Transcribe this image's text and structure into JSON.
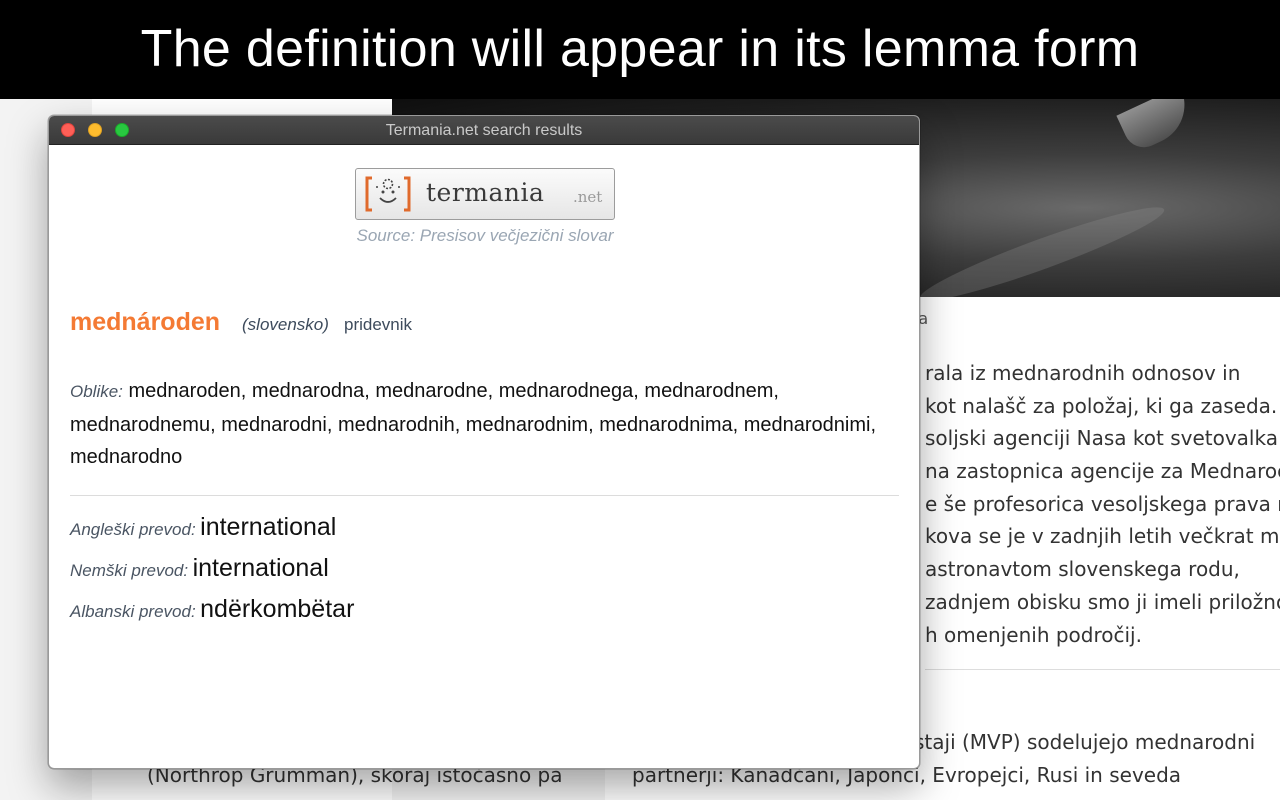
{
  "banner": {
    "text": "The definition will appear in its lemma form"
  },
  "background_page": {
    "caption": "sa",
    "body_lines": [
      "rala iz mednarodnih odnosov in",
      "kot nalašč za položaj, ki ga zaseda.",
      "soljski agenciji Nasa kot svetovalka z",
      "na zastopnica agencije za Mednaroc",
      "e še profesorica vesoljskega prava n",
      "kova se je v zadnjih letih večkrat muc",
      "astronavtom slovenskega rodu,",
      "zadnjem obisku smo ji imeli priložno",
      "h omenjenih področij."
    ],
    "line1": "staji (MVP) sodelujejo mednarodni",
    "line2": "partnerji: Kanadčani, Japonci, Evropejci, Rusi in seveda",
    "left_text": "(Northrop Grumman), skoraj istočasno pa"
  },
  "window": {
    "title": "Termania.net search results",
    "logo": {
      "word": "termania",
      "suffix": ".net"
    },
    "source": "Source: Presisov večjezični slovar",
    "entry": {
      "headword": "mednároden",
      "language": "(slovensko)",
      "part_of_speech": "pridevnik",
      "forms_label": "Oblike:",
      "forms": "mednaroden, mednarodna, mednarodne, mednarodnega, mednarodnem, mednarodnemu, mednarodni, mednarodnih, mednarodnim, mednarodnima, mednarodnimi, mednarodno"
    },
    "translations": [
      {
        "label": "Angleški prevod:",
        "value": "international"
      },
      {
        "label": "Nemški prevod:",
        "value": "international"
      },
      {
        "label": "Albanski prevod:",
        "value": "ndërkombëtar"
      }
    ]
  },
  "colors": {
    "headword": "#f47a34",
    "logo_bracket": "#e06a2c",
    "source": "#9aa6b3"
  }
}
